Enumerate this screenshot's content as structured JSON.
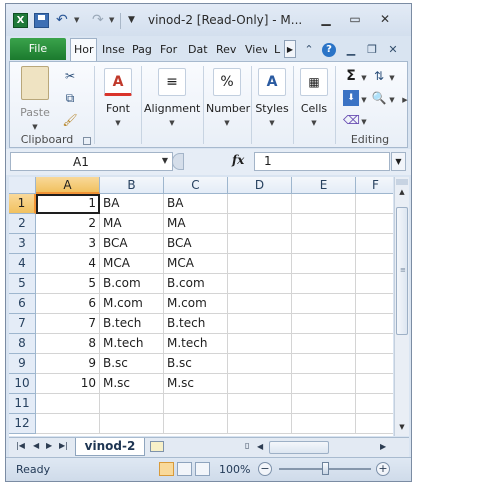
{
  "title": "vinod-2  [Read-Only]  -  M...",
  "app_icon_letter": "X",
  "tabs": [
    "File",
    "Hor",
    "Inse",
    "Pag",
    "For",
    "Dat",
    "Rev",
    "Viev",
    "L"
  ],
  "ribbon": {
    "clipboard_label": "Clipboard",
    "paste_label": "Paste",
    "font_label": "Font",
    "alignment_label": "Alignment",
    "number_label": "Number",
    "styles_label": "Styles",
    "cells_label": "Cells",
    "editing_label": "Editing"
  },
  "formula_bar": {
    "name_box": "A1",
    "fx": "fx",
    "formula": "1"
  },
  "columns": [
    "A",
    "B",
    "C",
    "D",
    "E",
    "F"
  ],
  "rows": [
    {
      "n": "1",
      "a": "1",
      "b": "BA",
      "c": "BA"
    },
    {
      "n": "2",
      "a": "2",
      "b": "MA",
      "c": "MA"
    },
    {
      "n": "3",
      "a": "3",
      "b": "BCA",
      "c": "BCA"
    },
    {
      "n": "4",
      "a": "4",
      "b": "MCA",
      "c": "MCA"
    },
    {
      "n": "5",
      "a": "5",
      "b": "B.com",
      "c": "B.com"
    },
    {
      "n": "6",
      "a": "6",
      "b": "M.com",
      "c": "M.com"
    },
    {
      "n": "7",
      "a": "7",
      "b": "B.tech",
      "c": "B.tech"
    },
    {
      "n": "8",
      "a": "8",
      "b": "M.tech",
      "c": "M.tech"
    },
    {
      "n": "9",
      "a": "9",
      "b": "B.sc",
      "c": "B.sc"
    },
    {
      "n": "10",
      "a": "10",
      "b": "M.sc",
      "c": "M.sc"
    },
    {
      "n": "11",
      "a": "",
      "b": "",
      "c": ""
    },
    {
      "n": "12",
      "a": "",
      "b": "",
      "c": ""
    }
  ],
  "sheet_tab": "vinod-2",
  "status": {
    "text": "Ready",
    "zoom": "100%",
    "zoom_level": 0.5
  }
}
